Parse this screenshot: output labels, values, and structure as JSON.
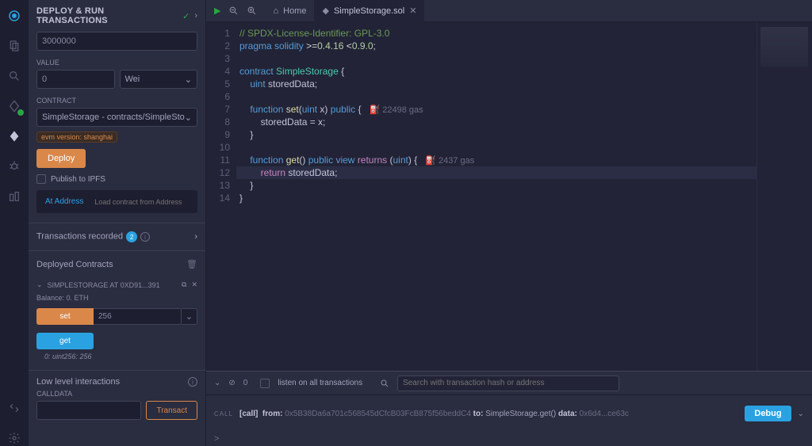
{
  "iconbar": {
    "icons": [
      "logo",
      "file",
      "search",
      "deploy",
      "solidity",
      "debugger",
      "plugin"
    ],
    "bottom": [
      "plug",
      "settings"
    ]
  },
  "panel": {
    "title": "DEPLOY & RUN TRANSACTIONS",
    "gas_limit_value": "3000000",
    "value_label": "VALUE",
    "value_amount": "0",
    "value_unit": "Wei",
    "contract_label": "CONTRACT",
    "contract_selected": "SimpleStorage - contracts/SimpleSto",
    "evm_badge": "evm version: shanghai",
    "deploy_btn": "Deploy",
    "publish_ipfs": "Publish to IPFS",
    "at_address_btn": "At Address",
    "at_address_placeholder": "Load contract from Address",
    "tx_recorded_label": "Transactions recorded",
    "tx_recorded_count": "2",
    "deployed_label": "Deployed Contracts",
    "instance_label": "SIMPLESTORAGE AT 0XD91...391",
    "balance": "Balance: 0. ETH",
    "fn_set": "set",
    "fn_set_arg": "256",
    "fn_get": "get",
    "ret_get": "0: uint256: 256",
    "low_level_label": "Low level interactions",
    "calldata_label": "CALLDATA",
    "transact_btn": "Transact"
  },
  "tabs": {
    "home": "Home",
    "file": "SimpleStorage.sol"
  },
  "code": {
    "lines": [
      {
        "n": "1",
        "html": "<span class='cm'>// SPDX-License-Identifier: GPL-3.0</span>"
      },
      {
        "n": "2",
        "html": "<span class='kw'>pragma</span> <span class='kw'>solidity</span> <span class='op'>&gt;=</span><span class='num'>0.4.16</span> <span class='op'>&lt;</span><span class='num'>0.9.0</span>;"
      },
      {
        "n": "3",
        "html": ""
      },
      {
        "n": "4",
        "html": "<span class='kw'>contract</span> <span class='type'>SimpleStorage</span> {"
      },
      {
        "n": "5",
        "html": "    <span class='kw'>uint</span> storedData;"
      },
      {
        "n": "6",
        "html": ""
      },
      {
        "n": "7",
        "html": "    <span class='kw'>function</span> <span class='fn'>set</span>(<span class='kw'>uint</span> x) <span class='kw'>public</span> {   <span class='gas'>⛽ 22498 gas</span>"
      },
      {
        "n": "8",
        "html": "        storedData = x;"
      },
      {
        "n": "9",
        "html": "    }"
      },
      {
        "n": "10",
        "html": ""
      },
      {
        "n": "11",
        "html": "    <span class='kw'>function</span> <span class='fn'>get</span>() <span class='kw'>public</span> <span class='kw'>view</span> <span class='kw2'>returns</span> (<span class='kw'>uint</span>) {   <span class='gas'>⛽ 2437 gas</span>"
      },
      {
        "n": "12",
        "html": "        <span class='kw2'>return</span> storedData;",
        "hl": true
      },
      {
        "n": "13",
        "html": "    }"
      },
      {
        "n": "14",
        "html": "}"
      }
    ]
  },
  "terminal": {
    "zero": "0",
    "listen": "listen on all transactions",
    "search_placeholder": "Search with transaction hash or address",
    "tag": "CALL",
    "call_label": "[call]",
    "from_label": "from:",
    "from_addr": "0x5B38Da6a701c568545dCfcB03FcB875f56beddC4",
    "to_label": "to:",
    "to_val": "SimpleStorage.get()",
    "data_label": "data:",
    "data_val": "0x6d4...ce63c",
    "debug_btn": "Debug",
    "prompt": ">"
  }
}
